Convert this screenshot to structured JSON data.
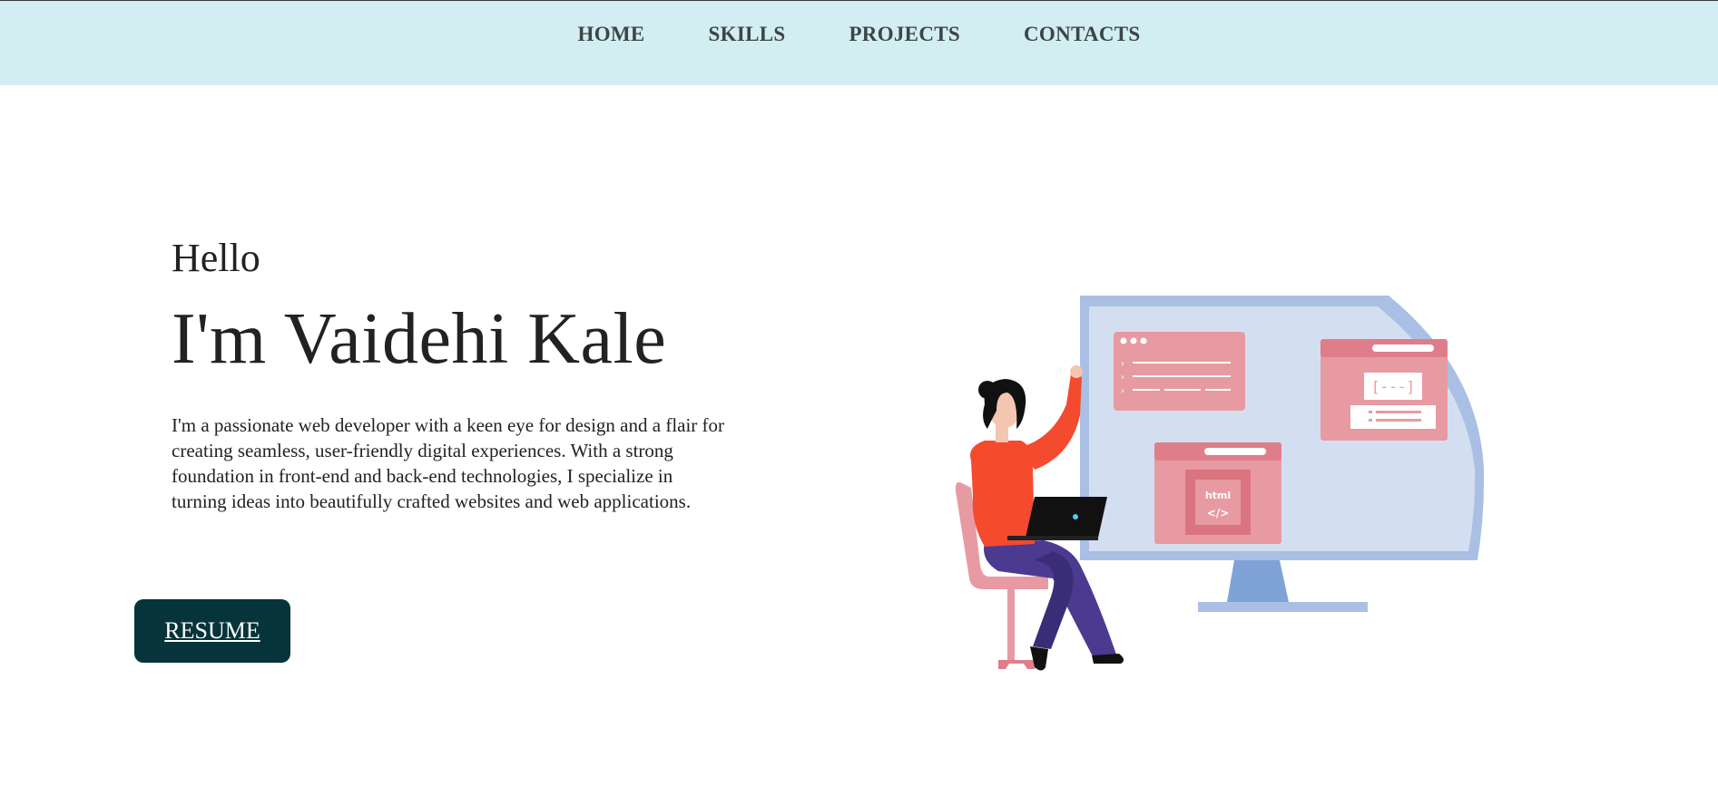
{
  "nav": {
    "items": [
      {
        "label": "HOME"
      },
      {
        "label": "SKILLS"
      },
      {
        "label": "PROJECTS"
      },
      {
        "label": "CONTACTS"
      }
    ]
  },
  "hero": {
    "greeting": "Hello",
    "name": "I'm Vaidehi Kale",
    "bio": "I'm a passionate web developer with a keen eye for design and a flair for creating seamless, user-friendly digital experiences. With a strong foundation in front-end and back-end technologies, I specialize in turning ideas into beautifully crafted websites and web applications.",
    "resume_label": "RESUME"
  },
  "illustration": {
    "code_card_line1": "html",
    "code_card_line2": "</>",
    "bracket_card": "[---]"
  },
  "colors": {
    "nav_bg": "#d2eef2",
    "button_bg": "#07343a",
    "monitor": "#a9c0e4",
    "card": "#e89aa3",
    "shirt": "#f44a2e",
    "pants": "#4b3a90"
  }
}
